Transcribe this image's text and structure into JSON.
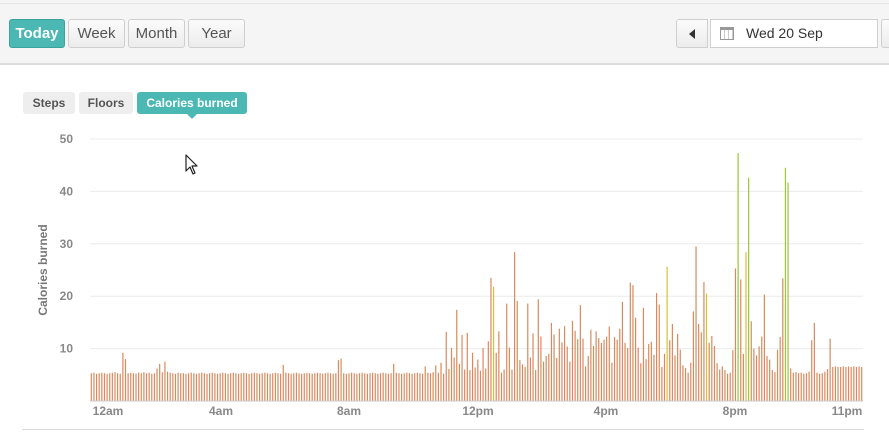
{
  "range_tabs": [
    "Today",
    "Week",
    "Month",
    "Year"
  ],
  "active_range": "Today",
  "date": {
    "value": "Wed 20 Sep"
  },
  "icons": {
    "prev": "chevron-left-icon",
    "calendar": "calendar-icon",
    "cursor": "mouse-pointer-icon"
  },
  "metric_tabs": [
    "Steps",
    "Floors",
    "Calories burned"
  ],
  "active_metric": "Calories burned",
  "colors": {
    "accent": "#4bb8b3",
    "bar_low": "#d88a5e",
    "bar_mid": "#d9c232",
    "bar_high": "#9cc63a"
  },
  "chart_data": {
    "type": "bar",
    "ylabel": "Calories burned",
    "xlabel": "",
    "ylim": [
      0,
      50
    ],
    "yticks": [
      10,
      20,
      30,
      40,
      50
    ],
    "xticks": [
      "12am",
      "4am",
      "8am",
      "12pm",
      "4pm",
      "8pm",
      "11pm"
    ],
    "x": "one bar per minute-interval over the day (~288 bars)",
    "values": [
      5.3,
      5.4,
      5.2,
      5.3,
      5.4,
      5.3,
      5.2,
      5.3,
      5.4,
      5.5,
      5.3,
      5.2,
      9.2,
      8.0,
      5.3,
      5.4,
      5.3,
      5.2,
      5.4,
      5.3,
      5.5,
      5.3,
      5.4,
      5.2,
      5.3,
      6.2,
      7.1,
      5.5,
      7.5,
      5.6,
      5.4,
      5.3,
      5.2,
      5.4,
      5.3,
      5.3,
      5.2,
      5.3,
      5.4,
      5.3,
      5.2,
      5.3,
      5.4,
      5.3,
      5.2,
      5.3,
      5.4,
      5.3,
      5.2,
      5.3,
      5.4,
      5.3,
      5.2,
      5.3,
      5.4,
      5.3,
      5.2,
      5.3,
      5.4,
      5.3,
      5.2,
      5.3,
      5.4,
      5.3,
      5.2,
      5.3,
      5.4,
      5.3,
      5.2,
      5.3,
      5.4,
      5.3,
      5.2,
      6.9,
      5.4,
      5.3,
      5.2,
      5.3,
      5.4,
      5.3,
      5.2,
      5.3,
      5.4,
      5.3,
      5.2,
      5.3,
      5.4,
      5.3,
      5.2,
      5.3,
      5.4,
      5.3,
      5.2,
      5.3,
      7.8,
      8.1,
      5.3,
      5.2,
      5.3,
      5.4,
      5.3,
      5.2,
      5.3,
      5.4,
      5.3,
      5.2,
      5.3,
      5.4,
      5.3,
      5.2,
      5.3,
      5.4,
      5.3,
      5.2,
      5.3,
      7.1,
      5.4,
      5.3,
      5.2,
      5.3,
      5.4,
      5.3,
      5.2,
      5.3,
      5.4,
      5.3,
      5.2,
      6.6,
      5.4,
      5.3,
      5.5,
      6.8,
      5.4,
      7.3,
      5.2,
      13.2,
      6.1,
      10.1,
      8.3,
      17.4,
      7.1,
      12.6,
      6.0,
      13.0,
      5.9,
      9.2,
      6.4,
      7.9,
      5.8,
      10.1,
      6.2,
      11.4,
      23.5,
      21.8,
      9.2,
      13.3,
      5.4,
      6.0,
      18.6,
      10.2,
      6.0,
      28.4,
      19.1,
      7.8,
      7.0,
      6.5,
      18.6,
      8.3,
      12.9,
      5.9,
      19.4,
      12.3,
      7.5,
      8.6,
      9.0,
      14.9,
      12.7,
      8.2,
      13.8,
      11.2,
      14.3,
      10.4,
      7.5,
      15.3,
      13.4,
      11.8,
      18.3,
      11.9,
      6.6,
      8.6,
      13.6,
      10.5,
      13.3,
      12.0,
      11.1,
      11.7,
      12.3,
      14.2,
      7.3,
      12.2,
      11.7,
      13.8,
      18.9,
      11.1,
      10.1,
      22.6,
      22.1,
      15.9,
      10.2,
      7.2,
      17.8,
      8.0,
      10.9,
      11.3,
      8.8,
      20.6,
      18.4,
      6.5,
      9.0,
      25.6,
      11.6,
      14.7,
      8.7,
      12.8,
      9.8,
      6.8,
      6.3,
      5.4,
      7.3,
      17.1,
      29.5,
      14.7,
      13.1,
      22.7,
      20.5,
      11.1,
      12.4,
      10.5,
      7.2,
      6.0,
      6.6,
      5.9,
      5.2,
      5.4,
      9.7,
      25.3,
      47.3,
      23.2,
      9.0,
      28.4,
      42.6,
      15.2,
      10.0,
      8.7,
      10.4,
      12.3,
      20.3,
      8.6,
      7.9,
      5.9,
      5.5,
      9.8,
      12.2,
      23.4,
      44.5,
      41.7,
      6.2,
      5.4,
      5.5,
      5.3,
      5.4,
      5.2,
      5.3,
      5.6,
      11.6,
      14.9,
      5.4,
      5.2,
      5.3,
      5.6,
      6.1,
      11.9,
      6.5,
      6.6,
      6.5,
      6.5,
      6.6,
      6.5,
      6.6,
      6.5,
      6.6,
      6.5,
      6.6,
      6.5
    ]
  }
}
